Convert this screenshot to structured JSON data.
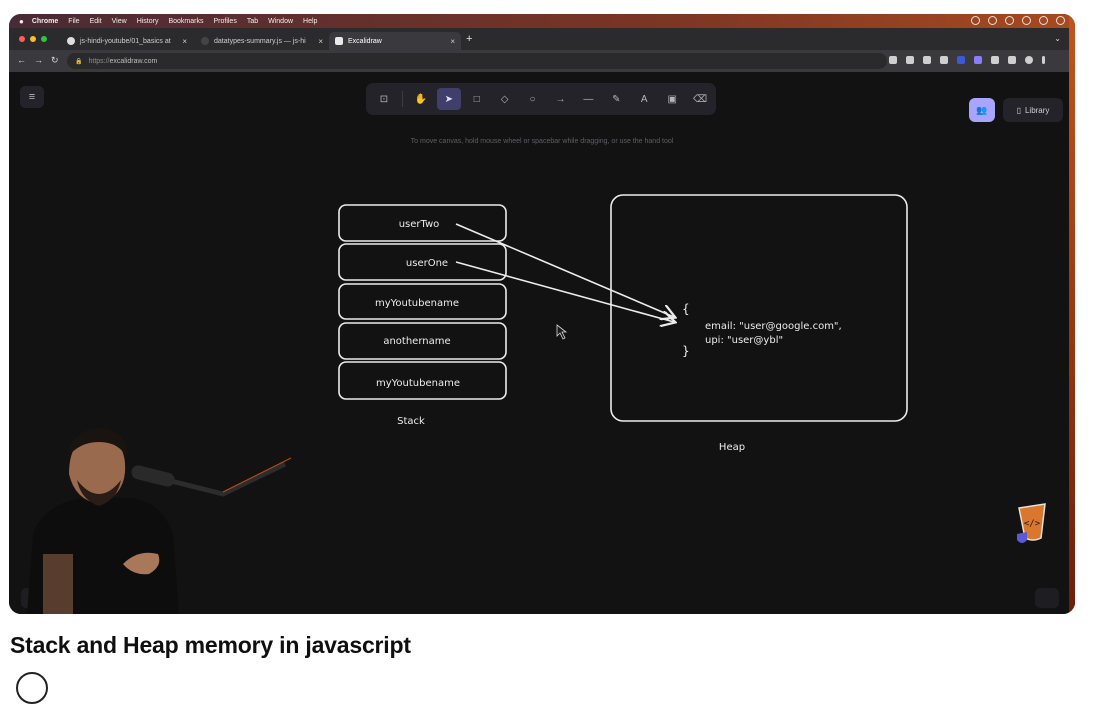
{
  "menubar": {
    "items": [
      "Chrome",
      "File",
      "Edit",
      "View",
      "History",
      "Bookmarks",
      "Profiles",
      "Tab",
      "Window",
      "Help"
    ]
  },
  "browser": {
    "tabs": [
      {
        "label": "js-hindi-youtube/01_basics at",
        "icon": "github-icon"
      },
      {
        "label": "datatypes-summary.js — js-hi",
        "icon": "code-file-icon"
      },
      {
        "label": "Excalidraw",
        "icon": "excalidraw-icon",
        "active": true
      }
    ],
    "url_prefix": "https://",
    "url": "excalidraw.com"
  },
  "excalidraw": {
    "hint": "To move canvas, hold mouse wheel or spacebar while dragging, or use the hand tool",
    "library_label": "Library",
    "tools": [
      {
        "name": "lock-icon",
        "glyph": "⊡",
        "key": ""
      },
      {
        "name": "hand-icon",
        "glyph": "✋",
        "key": ""
      },
      {
        "name": "selection-icon",
        "glyph": "➤",
        "key": "1",
        "active": true
      },
      {
        "name": "rectangle-icon",
        "glyph": "□",
        "key": "2"
      },
      {
        "name": "diamond-icon",
        "glyph": "◇",
        "key": "3"
      },
      {
        "name": "ellipse-icon",
        "glyph": "○",
        "key": "4"
      },
      {
        "name": "arrow-icon",
        "glyph": "→",
        "key": "5"
      },
      {
        "name": "line-icon",
        "glyph": "—",
        "key": "6"
      },
      {
        "name": "pencil-icon",
        "glyph": "✎",
        "key": "7"
      },
      {
        "name": "text-icon",
        "glyph": "A",
        "key": "8"
      },
      {
        "name": "image-icon",
        "glyph": "▣",
        "key": "9"
      },
      {
        "name": "eraser-icon",
        "glyph": "⌫",
        "key": "0"
      }
    ]
  },
  "diagram": {
    "stack_items": [
      "userTwo",
      "userOne",
      "myYoutubename",
      "anothername",
      "myYoutubename"
    ],
    "stack_label": "Stack",
    "heap_label": "Heap",
    "heap_open": "{",
    "heap_line1": "email: \"user@google.com\",",
    "heap_line2": "upi: \"user@ybl\"",
    "heap_close": "}"
  },
  "video": {
    "title": "Stack and Heap memory in javascript"
  },
  "colors": {
    "accent": "#a8a5ff",
    "canvas_bg": "#121212",
    "stroke": "#ececec"
  }
}
